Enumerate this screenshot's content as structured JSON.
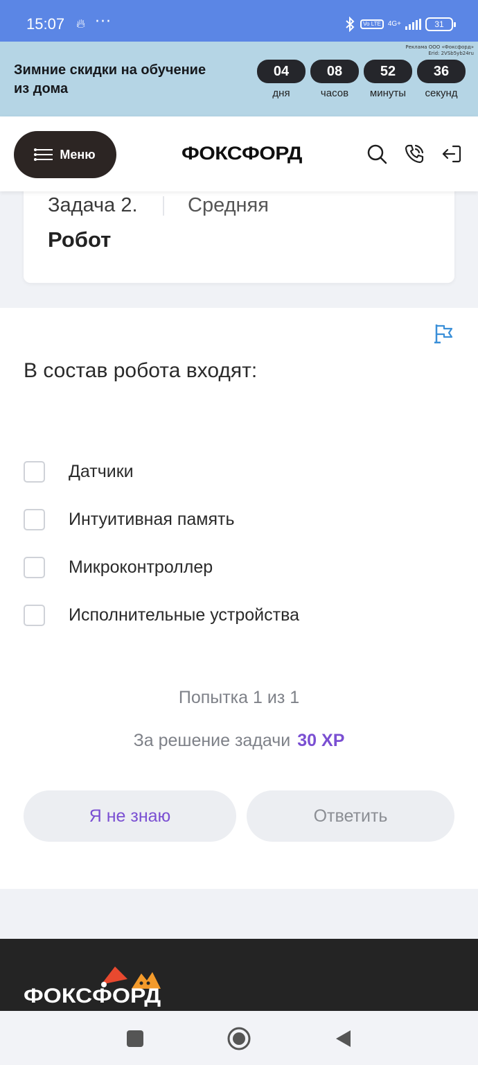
{
  "status_bar": {
    "time": "15:07",
    "dots": "···",
    "volte": "Vo LTE",
    "network": "4G+",
    "battery": "31"
  },
  "promo": {
    "title": "Зимние скидки на обучение из дома",
    "legal_line1": "Реклама ООО «Фоксфорд»",
    "legal_line2": "Erid: 2VSb5yb24ru",
    "countdown": [
      {
        "value": "04",
        "label": "дня"
      },
      {
        "value": "08",
        "label": "часов"
      },
      {
        "value": "52",
        "label": "минуты"
      },
      {
        "value": "36",
        "label": "секунд"
      }
    ]
  },
  "header": {
    "menu_label": "Меню",
    "logo": "ФОКСФОРД"
  },
  "task": {
    "number": "Задача 2.",
    "level": "Средняя",
    "name": "Робот"
  },
  "question": {
    "text": "В состав робота входят:",
    "options": [
      {
        "label": "Датчики",
        "checked": false
      },
      {
        "label": "Интуитивная память",
        "checked": false
      },
      {
        "label": "Микроконтроллер",
        "checked": false
      },
      {
        "label": "Исполнительные устройства",
        "checked": false
      }
    ]
  },
  "attempt_text": "Попытка 1 из 1",
  "reward": {
    "label": "За решение задачи",
    "xp": "30 XP"
  },
  "buttons": {
    "dont_know": "Я не знаю",
    "answer": "Ответить"
  },
  "footer": {
    "logo": "ФОКСФОРД"
  },
  "colors": {
    "status_bar": "#5b86e5",
    "promo_bg": "#b5d5e5",
    "accent_purple": "#7a4fd2",
    "menu_bg": "#2c2523",
    "footer_bg": "#242424"
  },
  "icons": [
    "flame-icon",
    "bluetooth-icon",
    "signal-icon",
    "battery-icon",
    "menu-icon",
    "search-icon",
    "phone-icon",
    "login-icon",
    "report-flag-icon",
    "stop-icon",
    "home-icon",
    "back-icon"
  ]
}
